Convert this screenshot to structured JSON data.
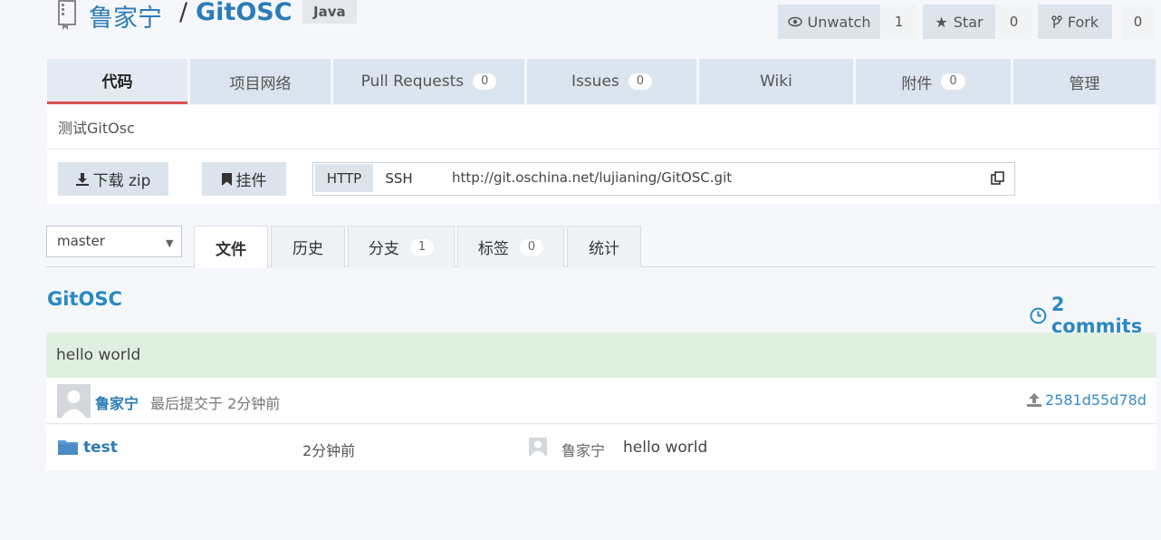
{
  "header": {
    "owner": "鲁家宁",
    "separator": "/",
    "repo": "GitOSC",
    "language": "Java",
    "unwatch_label": "Unwatch",
    "unwatch_count": "1",
    "star_label": "Star",
    "star_count": "0",
    "fork_label": "Fork",
    "fork_count": "0"
  },
  "tabs": [
    {
      "label": "代码"
    },
    {
      "label": "项目网络"
    },
    {
      "label": "Pull Requests",
      "count": "0"
    },
    {
      "label": "Issues",
      "count": "0"
    },
    {
      "label": "Wiki"
    },
    {
      "label": "附件",
      "count": "0"
    },
    {
      "label": "管理"
    }
  ],
  "description": "测试GitOsc",
  "actions": {
    "download_label": "下载 zip",
    "widget_label": "挂件",
    "protocols": [
      "HTTP",
      "SSH"
    ],
    "clone_url": "http://git.oschina.net/lujianing/GitOSC.git"
  },
  "branch": {
    "selected": "master"
  },
  "subtabs": [
    {
      "label": "文件"
    },
    {
      "label": "历史"
    },
    {
      "label": "分支",
      "count": "1"
    },
    {
      "label": "标签",
      "count": "0"
    },
    {
      "label": "统计"
    }
  ],
  "project": {
    "title": "GitOSC",
    "commits": "2 commits"
  },
  "last_commit": {
    "message": "hello world",
    "author": "鲁家宁",
    "meta": "最后提交于 2分钟前",
    "sha": "2581d55d78d"
  },
  "files": [
    {
      "name": "test",
      "time": "2分钟前",
      "author": "鲁家宁",
      "message": "hello world"
    }
  ],
  "colors": {
    "accent": "#2b7cb8",
    "active_tab_border": "#d9534f",
    "commit_bg": "#dff0e0"
  },
  "icons": [
    "repo-icon",
    "eye-icon",
    "star-icon",
    "fork-icon",
    "download-icon",
    "bookmark-icon",
    "copy-icon",
    "clock-icon",
    "upload-icon",
    "folder-icon"
  ]
}
